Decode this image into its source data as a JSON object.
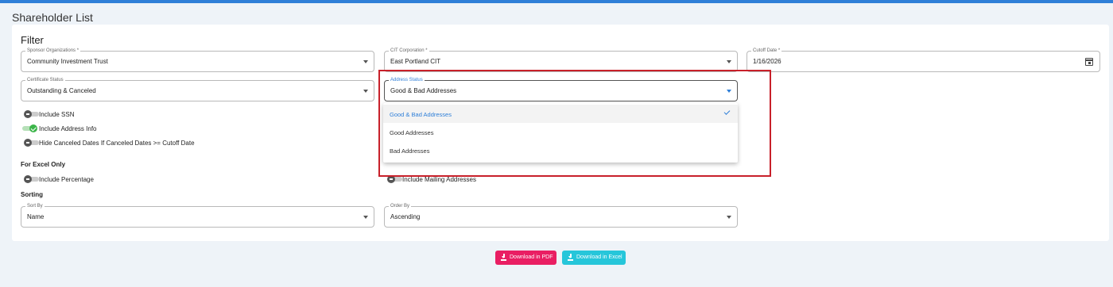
{
  "page": {
    "title": "Shareholder List"
  },
  "filter": {
    "title": "Filter",
    "sponsor": {
      "label": "Sponsor Organizations *",
      "value": "Community Investment Trust"
    },
    "cit": {
      "label": "CIT Corporation *",
      "value": "East Portland CIT"
    },
    "cutoff": {
      "label": "Cutoff Date *",
      "value": "1/16/2026"
    },
    "certificate": {
      "label": "Certificate Status",
      "value": "Outstanding & Canceled"
    },
    "address": {
      "label": "Address Status",
      "value": "Good & Bad Addresses"
    }
  },
  "toggles": {
    "ssn": {
      "label": "Include SSN",
      "on": false
    },
    "address_info": {
      "label": "Include Address Info",
      "on": true
    },
    "hide_canceled": {
      "label": "Hide Canceled Dates If Canceled Dates >= Cutoff Date",
      "on": false
    }
  },
  "excel": {
    "title": "For Excel Only",
    "percentage": {
      "label": "Include Percentage",
      "on": false
    },
    "mailing": {
      "label": "Include Mailing Addresses",
      "on": false
    }
  },
  "sorting": {
    "title": "Sorting",
    "sort_by": {
      "label": "Sort By",
      "value": "Name"
    },
    "order_by": {
      "label": "Order By",
      "value": "Ascending"
    }
  },
  "dropdown": {
    "options": [
      {
        "label": "Good & Bad Addresses",
        "selected": true
      },
      {
        "label": "Good Addresses",
        "selected": false
      },
      {
        "label": "Bad Addresses",
        "selected": false
      }
    ]
  },
  "actions": {
    "pdf": "Download in PDF",
    "excel": "Download in Excel"
  },
  "colors": {
    "accent": "#2f7fd8",
    "pdf_button": "#e91e63",
    "excel_button": "#26c6da",
    "highlight_box": "#c8202a",
    "toggle_on": "#3cb54a"
  },
  "icons": [
    "chevron-down-icon",
    "calendar-icon",
    "check-icon",
    "download-icon"
  ]
}
